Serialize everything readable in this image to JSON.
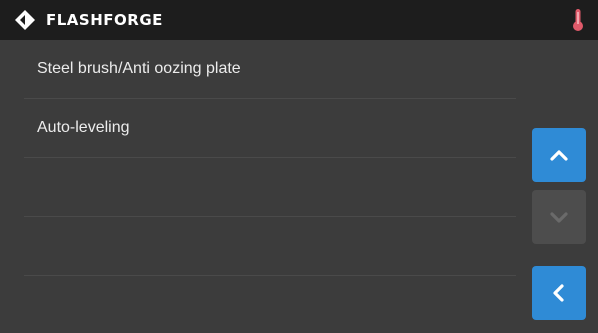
{
  "header": {
    "brand": "FLASHFORGE",
    "logo_icon": "flashforge-logo-icon",
    "status_icon": "thermometer-icon",
    "colors": {
      "bar": "#1d1d1d",
      "status_icon": "#e05a6a"
    }
  },
  "menu": {
    "items": [
      {
        "label": "Steel brush/Anti oozing plate"
      },
      {
        "label": "Auto-leveling"
      },
      {
        "label": ""
      },
      {
        "label": ""
      }
    ]
  },
  "controls": {
    "scroll_up": {
      "icon": "chevron-up-icon",
      "enabled": true
    },
    "scroll_down": {
      "icon": "chevron-down-icon",
      "enabled": false
    },
    "back": {
      "icon": "chevron-left-icon"
    }
  },
  "colors": {
    "background": "#3c3c3c",
    "accent": "#2f8bd6",
    "disabled": "#4d4d4d"
  }
}
